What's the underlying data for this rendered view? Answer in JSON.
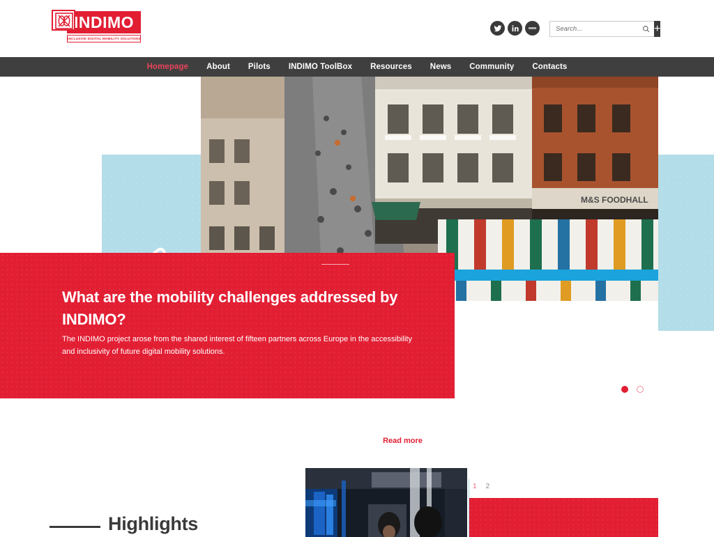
{
  "brand": {
    "name": "INDIMO",
    "tagline": "INCLUSIVE DIGITAL MOBILITY SOLUTIONS",
    "accent_color": "#E21E33",
    "nav_bg_color": "#3F3F3F",
    "panel_blue_color": "#B3DDE8"
  },
  "header": {
    "social": [
      {
        "name": "twitter-icon",
        "label": "Twitter"
      },
      {
        "name": "linkedin-icon",
        "label": "LinkedIn",
        "text": "in"
      },
      {
        "name": "website-icon",
        "label": "Website",
        "text": "www"
      }
    ],
    "search": {
      "placeholder": "Search...",
      "value": "",
      "submit_label": "+"
    }
  },
  "nav": {
    "items": [
      {
        "label": "Homepage",
        "active": true
      },
      {
        "label": "About",
        "active": false
      },
      {
        "label": "Pilots",
        "active": false
      },
      {
        "label": "INDIMO ToolBox",
        "active": false
      },
      {
        "label": "Resources",
        "active": false
      },
      {
        "label": "News",
        "active": false
      },
      {
        "label": "Community",
        "active": false
      },
      {
        "label": "Contacts",
        "active": false
      }
    ]
  },
  "hero": {
    "icon": "megaphone-icon",
    "photo_alt": "Aerial view of a busy pedestrian shopping street with market stalls",
    "banner": {
      "title": "What are the mobility challenges addressed by INDIMO?",
      "subtitle": "The INDIMO project arose from the shared interest of fifteen partners across Europe in the accessibility and inclusivity of future digital mobility solutions.",
      "cta_label": "Read more"
    },
    "carousel": {
      "slides": [
        "1",
        "2"
      ],
      "active_index": 0
    }
  },
  "highlights": {
    "title": "Highlights",
    "photo_alt": "Interior of a modern metro train carriage with blue lighting",
    "pager": [
      {
        "label": "1",
        "active": true
      },
      {
        "label": "2",
        "active": false
      }
    ]
  }
}
